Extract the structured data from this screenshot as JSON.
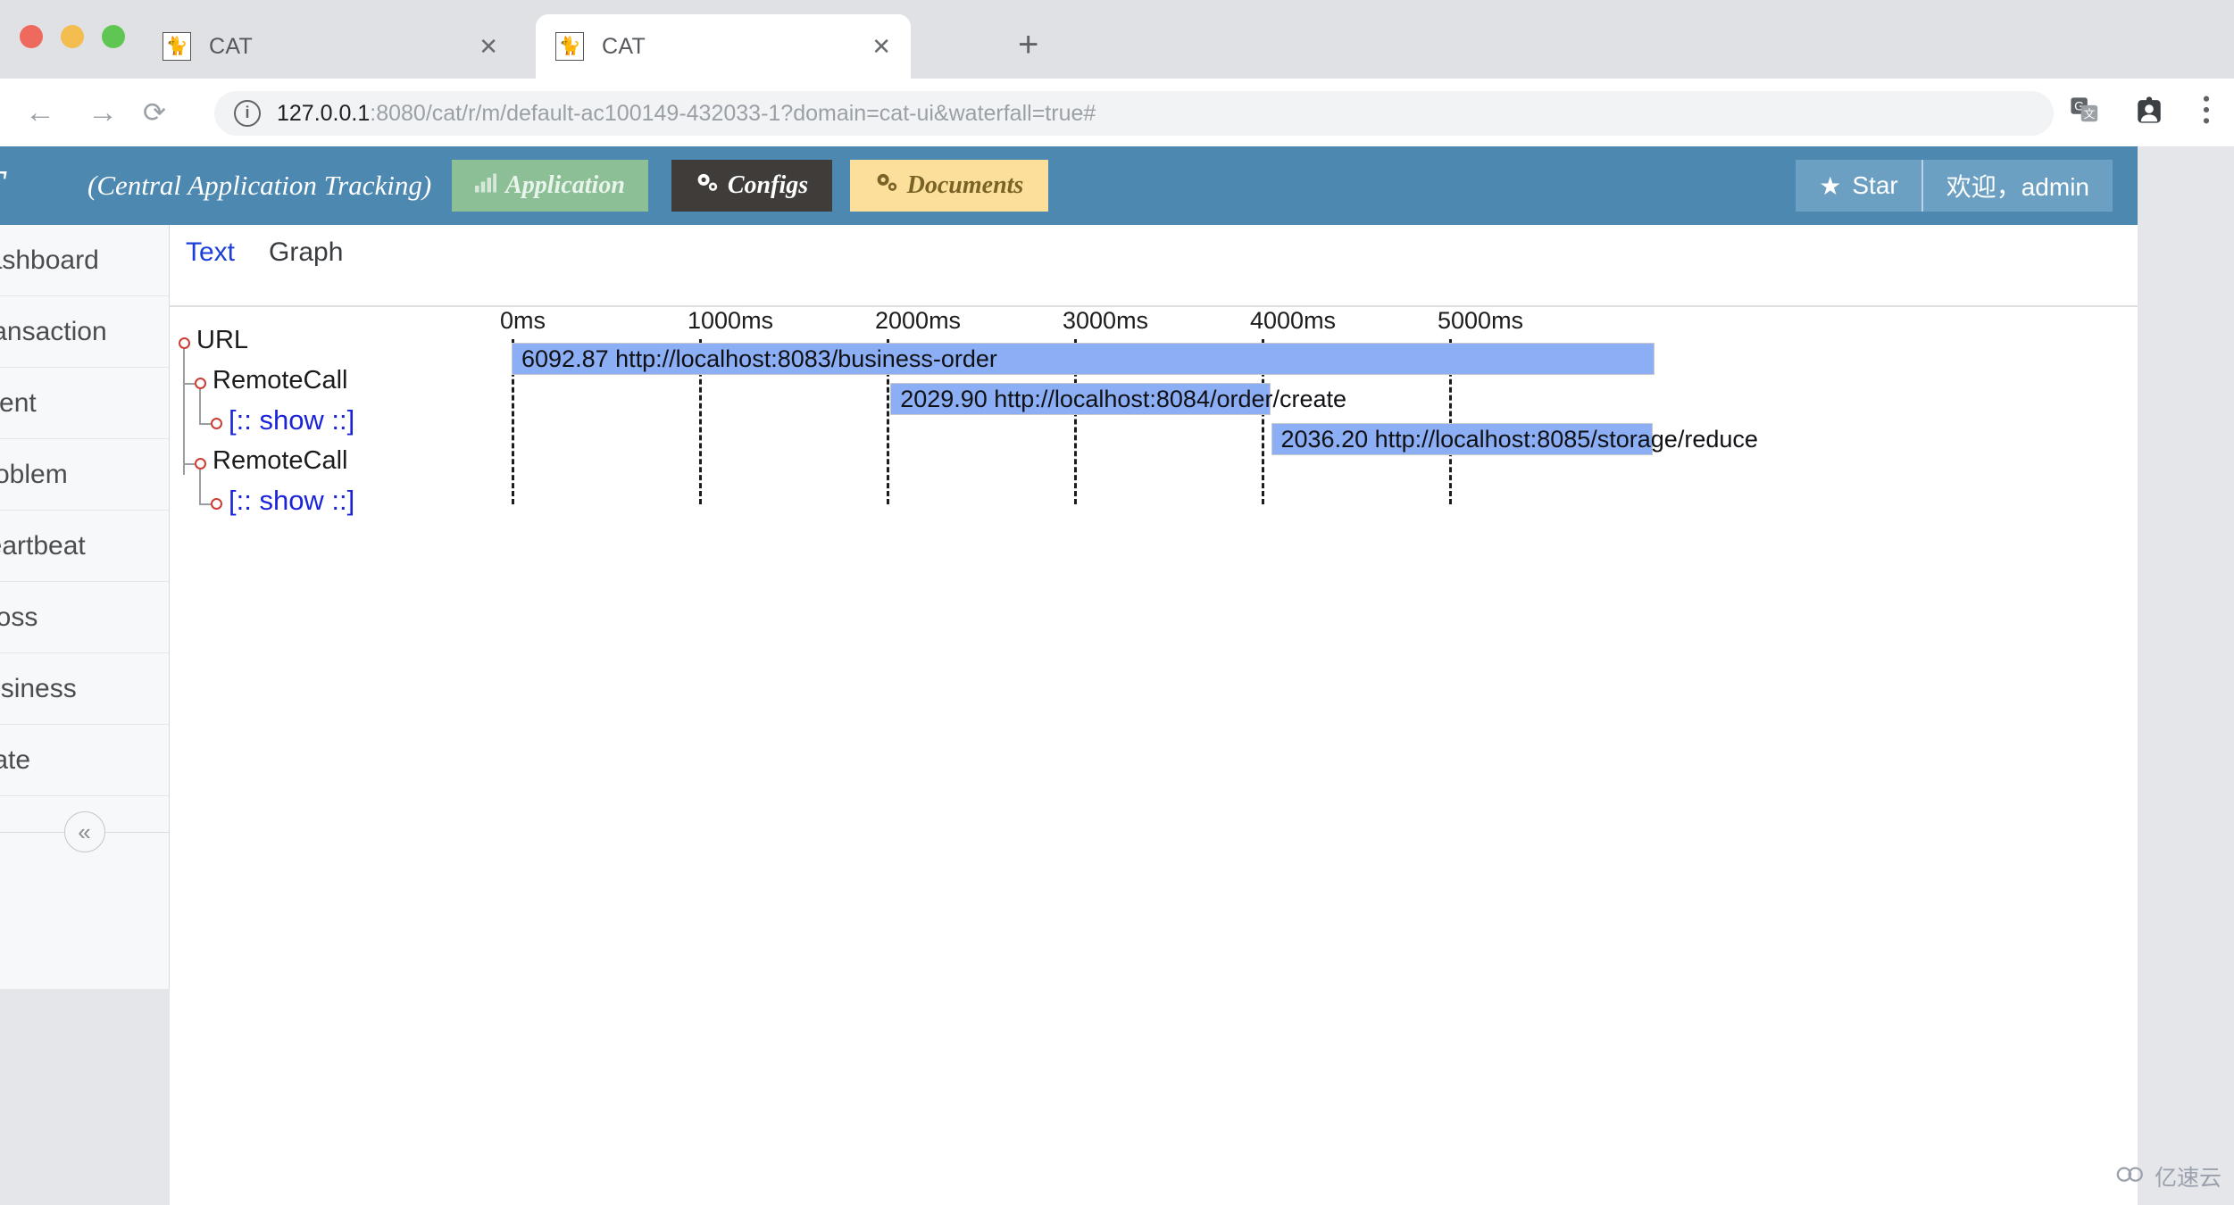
{
  "browser": {
    "tabs": [
      {
        "title": "CAT",
        "favicon": "cat-favicon",
        "active": false
      },
      {
        "title": "CAT",
        "favicon": "cat-favicon",
        "active": true
      }
    ],
    "new_tab_label": "+",
    "close_label": "✕",
    "nav": {
      "back": "←",
      "forward": "→",
      "reload": "⟳"
    },
    "omnibox": {
      "info_icon": "i",
      "url_host": "127.0.0.1",
      "url_rest": ":8080/cat/r/m/default-ac100149-432033-1?domain=cat-ui&waterfall=true#",
      "full_url": "127.0.0.1:8080/cat/r/m/default-ac100149-432033-1?domain=cat-ui&waterfall=true#"
    },
    "icons": {
      "translate": "translate-icon",
      "profile": "profile-icon",
      "menu": "⋮"
    }
  },
  "app_header": {
    "brand": "T",
    "brand_sub": "(Central Application Tracking)",
    "nav": [
      {
        "label": "Application",
        "icon": "bar-chart-icon",
        "color": "#8cbf96"
      },
      {
        "label": "Configs",
        "icon": "gears-icon",
        "color": "#3f3c3a"
      },
      {
        "label": "Documents",
        "icon": "gears-icon",
        "color": "#fbdf9b"
      }
    ],
    "star_label": "Star",
    "star_icon": "★",
    "user_label": "欢迎，admin"
  },
  "sidebar": {
    "items": [
      {
        "label": "Dashboard"
      },
      {
        "label": "Transaction"
      },
      {
        "label": "Event"
      },
      {
        "label": "Problem"
      },
      {
        "label": "Heartbeat"
      },
      {
        "label": "Cross"
      },
      {
        "label": "Business"
      },
      {
        "label": "State"
      }
    ],
    "collapse_icon": "«"
  },
  "content": {
    "tabs": [
      {
        "label": "Text",
        "active": true
      },
      {
        "label": "Graph",
        "active": false
      }
    ]
  },
  "chart_data": {
    "type": "bar",
    "title": "",
    "xlabel": "",
    "ylabel": "",
    "orientation": "horizontal-waterfall",
    "axis_ticks": [
      "0ms",
      "1000ms",
      "2000ms",
      "3000ms",
      "4000ms",
      "5000ms"
    ],
    "axis_tick_values": [
      0,
      1000,
      2000,
      3000,
      4000,
      5000
    ],
    "xlim": [
      0,
      5400
    ],
    "grid": true,
    "tree": [
      {
        "label": "URL",
        "depth": 0,
        "type": "node"
      },
      {
        "label": "RemoteCall",
        "depth": 1,
        "type": "node"
      },
      {
        "label": "[:: show ::]",
        "depth": 2,
        "type": "link"
      },
      {
        "label": "RemoteCall",
        "depth": 1,
        "type": "node"
      },
      {
        "label": "[:: show ::]",
        "depth": 2,
        "type": "link"
      }
    ],
    "bars": [
      {
        "duration": "6092.87",
        "url": "http://localhost:8083/business-order",
        "label": "6092.87 http://localhost:8083/business-order",
        "start_ms": 0,
        "duration_ms": 6092.87,
        "row": 0
      },
      {
        "duration": "2029.90",
        "url": "http://localhost:8084/order/create",
        "label": "2029.90 http://localhost:8084/order/create",
        "start_ms": 2020,
        "duration_ms": 2029.9,
        "row": 1
      },
      {
        "duration": "2036.20",
        "url": "http://localhost:8085/storage/reduce",
        "label": "2036.20 http://localhost:8085/storage/reduce",
        "start_ms": 4050,
        "duration_ms": 2036.2,
        "row": 2
      }
    ]
  },
  "watermark": {
    "label": "亿速云",
    "icon": "cloud-icon"
  }
}
